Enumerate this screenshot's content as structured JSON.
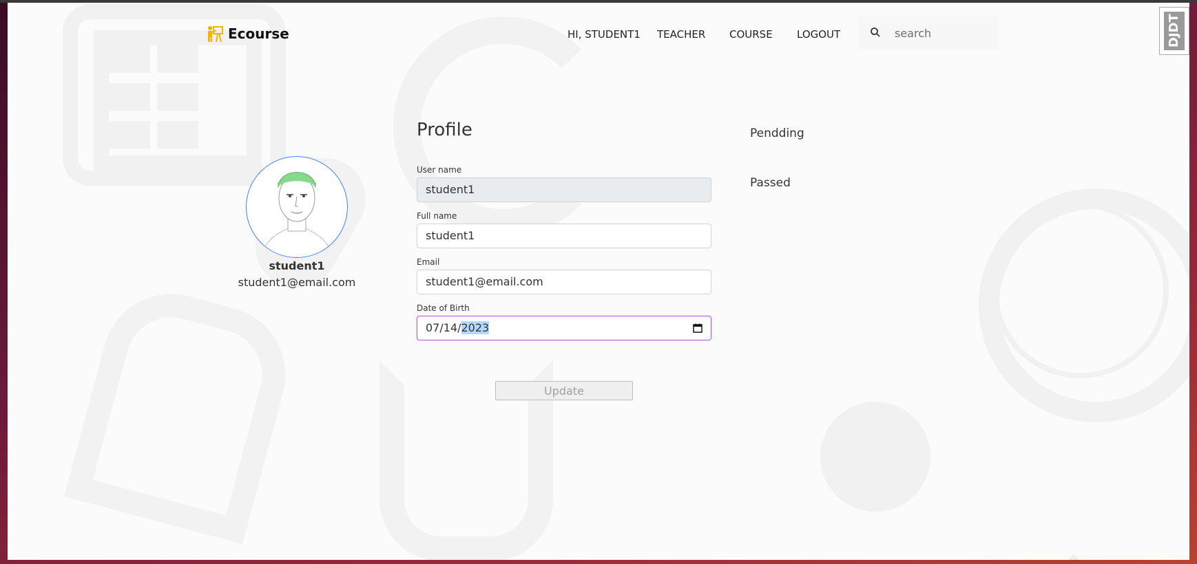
{
  "app": {
    "brand_name": "Ecourse",
    "brand_icon": "teacher-board-icon",
    "accent_color": "#f5b301"
  },
  "nav": {
    "greeting": "HI, STUDENT1",
    "teacher": "TEACHER",
    "course": "COURSE",
    "logout": "LOGOUT"
  },
  "search": {
    "placeholder": "search",
    "icon": "search-icon"
  },
  "profile": {
    "title": "Profile",
    "avatar_name": "student1",
    "avatar_email": "student1@email.com",
    "fields": {
      "username_label": "User name",
      "username_value": "student1",
      "fullname_label": "Full name",
      "fullname_value": "student1",
      "email_label": "Email",
      "email_value": "student1@email.com",
      "dob_label": "Date of Birth",
      "dob_month_day": "07/14/",
      "dob_year": "2023"
    },
    "update_label": "Update"
  },
  "side": {
    "pending": "Pendding",
    "passed": "Passed"
  },
  "toolbar": {
    "djdt_label": "DJDT"
  }
}
